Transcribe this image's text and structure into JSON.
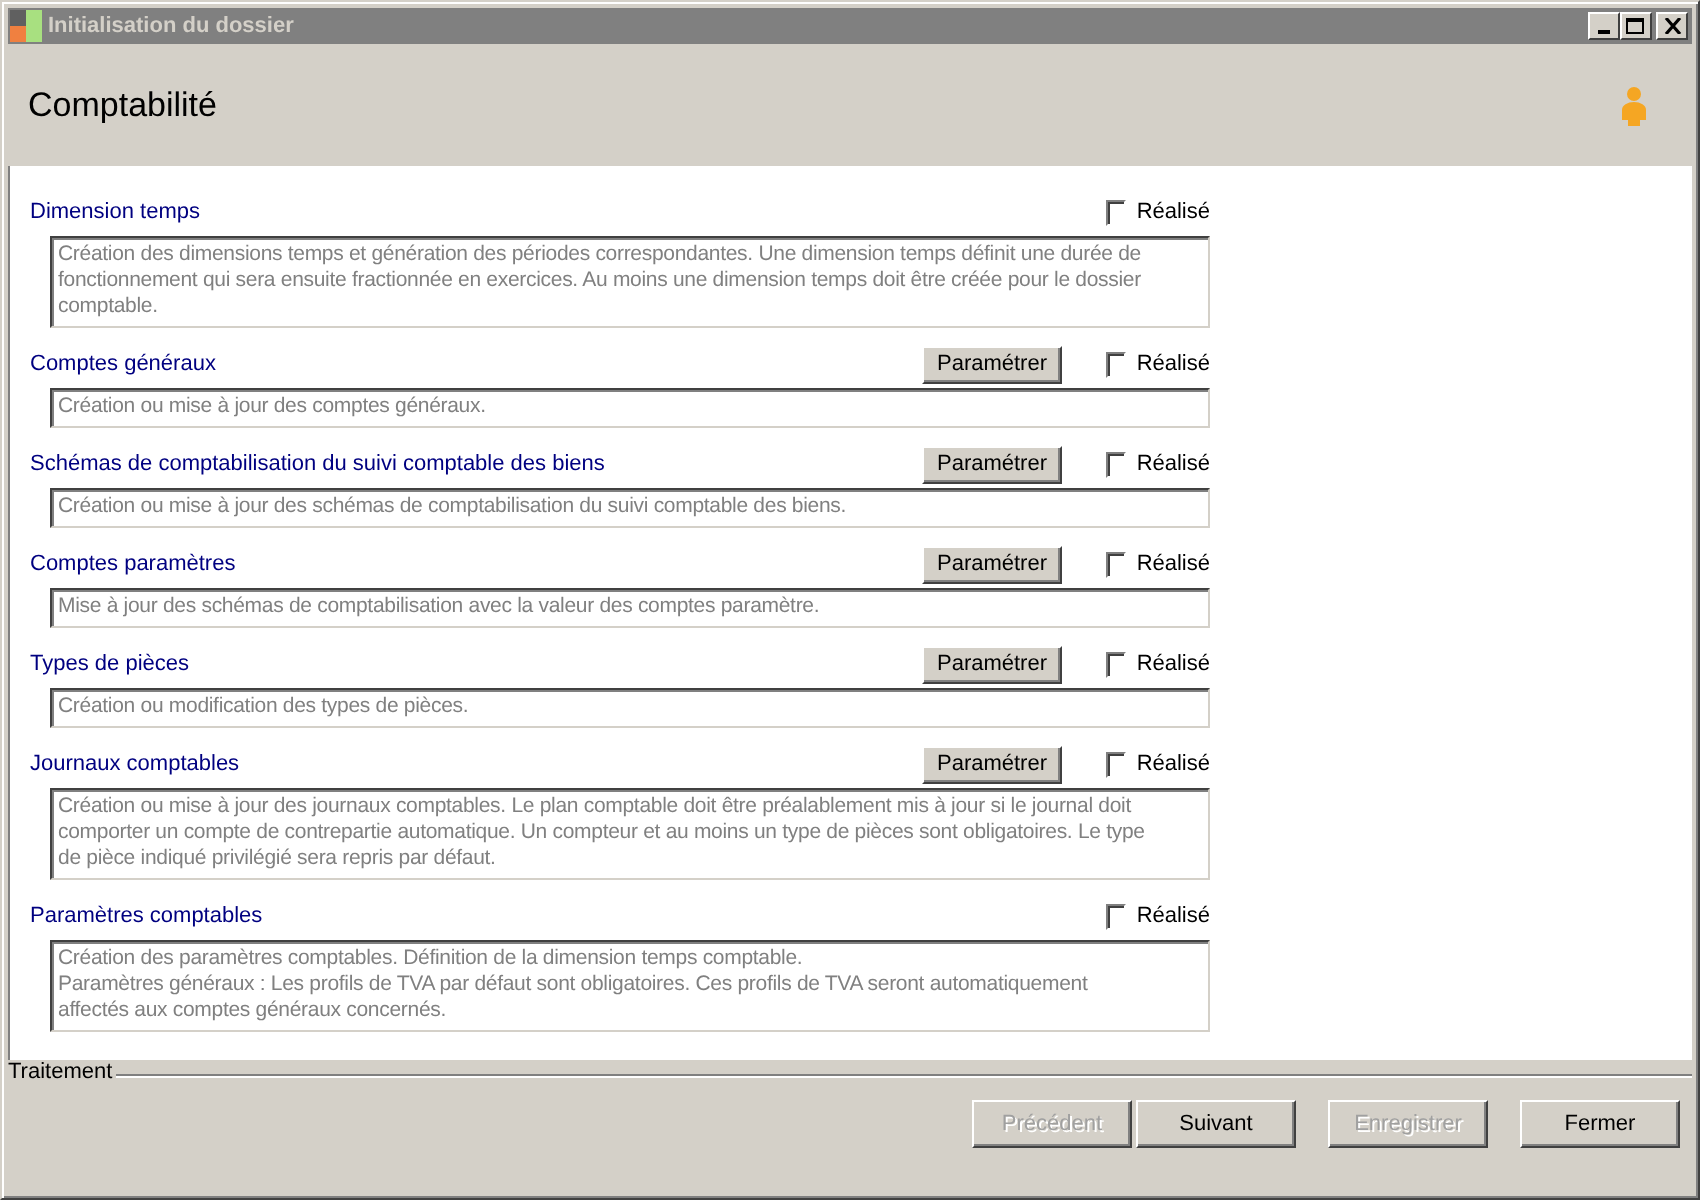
{
  "window": {
    "title": "Initialisation du dossier"
  },
  "header": {
    "title": "Comptabilité"
  },
  "sections": [
    {
      "title": "Dimension temps",
      "checkbox": {
        "label": "Réalisé",
        "checked": false
      },
      "description": [
        "Création des dimensions temps et génération des périodes correspondantes. Une dimension temps définit une durée de",
        "fonctionnement qui sera ensuite fractionnée en exercices. Au moins une dimension temps doit être créée pour le dossier",
        "comptable."
      ]
    },
    {
      "title": "Comptes généraux",
      "button": "Paramétrer",
      "checkbox": {
        "label": "Réalisé",
        "checked": false
      },
      "description": [
        "Création ou mise à jour des comptes généraux."
      ]
    },
    {
      "title": "Schémas de comptabilisation du suivi comptable des biens",
      "button": "Paramétrer",
      "checkbox": {
        "label": "Réalisé",
        "checked": false
      },
      "description": [
        "Création ou mise à jour des schémas de comptabilisation du suivi comptable des biens."
      ]
    },
    {
      "title": "Comptes paramètres",
      "button": "Paramétrer",
      "checkbox": {
        "label": "Réalisé",
        "checked": false
      },
      "description": [
        "Mise à jour des schémas de comptabilisation avec la valeur des comptes paramètre."
      ]
    },
    {
      "title": "Types de pièces",
      "button": "Paramétrer",
      "checkbox": {
        "label": "Réalisé",
        "checked": false
      },
      "description": [
        "Création ou modification des types de pièces."
      ]
    },
    {
      "title": "Journaux comptables",
      "button": "Paramétrer",
      "checkbox": {
        "label": "Réalisé",
        "checked": false
      },
      "description": [
        "Création ou mise à jour des journaux comptables. Le plan comptable doit être préalablement mis à jour si le journal doit",
        "comporter un compte de contrepartie automatique. Un compteur et au moins un type de pièces sont obligatoires. Le type",
        "de pièce indiqué privilégié sera repris par défaut."
      ]
    },
    {
      "title": "Paramètres comptables",
      "checkbox": {
        "label": "Réalisé",
        "checked": false
      },
      "description": [
        "Création des paramètres comptables. Définition de la dimension temps comptable.",
        "Paramètres généraux : Les profils de TVA par défaut sont obligatoires. Ces profils de TVA seront automatiquement",
        "affectés aux comptes généraux concernés."
      ]
    }
  ],
  "footer": {
    "group_label": "Traitement",
    "buttons": [
      {
        "label": "Précédent",
        "disabled": true
      },
      {
        "label": "Suivant",
        "disabled": false
      },
      {
        "label": "Enregistrer",
        "disabled": true
      },
      {
        "label": "Fermer",
        "disabled": false
      }
    ]
  }
}
